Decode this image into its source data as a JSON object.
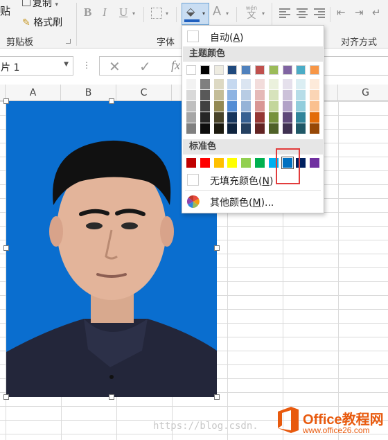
{
  "ribbon": {
    "clipboard": {
      "paste_label": "贴",
      "copy_label": "复制",
      "format_painter_label": "格式刷",
      "group_label": "剪贴板"
    },
    "font_group_label": "字体",
    "align_group_label": "对齐方式",
    "bold_label": "B",
    "italic_label": "I",
    "underline_label": "U",
    "font_color_label": "A",
    "phonetic_top": "wén",
    "phonetic_bottom": "文"
  },
  "formula_bar": {
    "name_box_value": "片 1",
    "fx_label": "fx"
  },
  "columns": [
    "A",
    "B",
    "C",
    "G"
  ],
  "fill_menu": {
    "auto_label": "自动(",
    "auto_hotkey": "A",
    "auto_suffix": ")",
    "theme_header": "主题颜色",
    "standard_header": "标准色",
    "no_fill_label": "无填充颜色(",
    "no_fill_hotkey": "N",
    "no_fill_suffix": ")",
    "more_colors_label": "其他颜色(",
    "more_colors_hotkey": "M",
    "more_colors_suffix": ")...",
    "theme_top": [
      "#ffffff",
      "#000000",
      "#eeece1",
      "#1f497d",
      "#4f81bd",
      "#c0504d",
      "#9bbb59",
      "#8064a2",
      "#4bacc6",
      "#f79646"
    ],
    "theme_shades": [
      [
        "#f2f2f2",
        "#d9d9d9",
        "#bfbfbf",
        "#a6a6a6",
        "#808080"
      ],
      [
        "#7f7f7f",
        "#595959",
        "#404040",
        "#262626",
        "#0d0d0d"
      ],
      [
        "#ddd9c3",
        "#c4bd97",
        "#938953",
        "#494429",
        "#1d1b10"
      ],
      [
        "#c6d9f0",
        "#8db3e2",
        "#548dd4",
        "#17365d",
        "#0f243e"
      ],
      [
        "#dbe5f1",
        "#b8cce4",
        "#95b3d7",
        "#366092",
        "#244061"
      ],
      [
        "#f2dcdb",
        "#e5b9b7",
        "#d99694",
        "#953734",
        "#632423"
      ],
      [
        "#ebf1dd",
        "#d7e3bc",
        "#c3d69b",
        "#76923c",
        "#4f6128"
      ],
      [
        "#e5e0ec",
        "#ccc1d9",
        "#b2a2c7",
        "#5f497a",
        "#3f3151"
      ],
      [
        "#dbeef3",
        "#b7dde8",
        "#92cddc",
        "#31859b",
        "#205867"
      ],
      [
        "#fdeada",
        "#fbd5b5",
        "#fac08f",
        "#e36c09",
        "#974806"
      ]
    ],
    "standard": [
      "#c00000",
      "#ff0000",
      "#ffc000",
      "#ffff00",
      "#92d050",
      "#00b050",
      "#00b0f0",
      "#0070c0",
      "#002060",
      "#7030a0"
    ]
  },
  "watermark": {
    "url_text": "https://blog.csdn.",
    "brand": "Office教程网",
    "site": "www.office26.com"
  },
  "colors": {
    "photo_background": "#0a6ecf",
    "highlight_box": "#e23c3c",
    "brand_orange": "#e85a0e"
  }
}
